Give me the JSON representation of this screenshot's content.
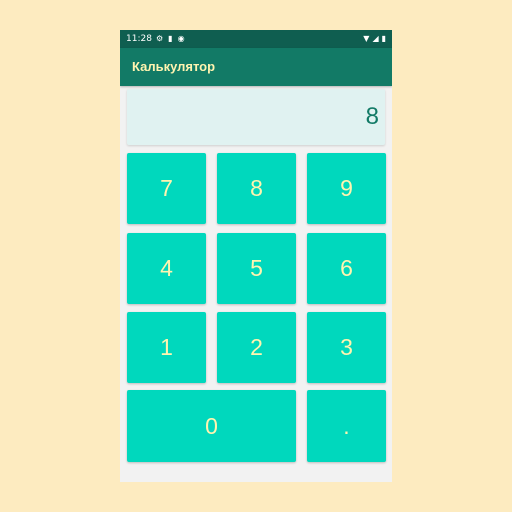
{
  "status_bar": {
    "time": "11:28",
    "left_icons": [
      "gear-icon",
      "sd-card-icon",
      "sync-icon"
    ],
    "right_icons": [
      "wifi-icon",
      "signal-icon",
      "battery-icon"
    ]
  },
  "app_bar": {
    "title": "Калькулятор"
  },
  "display": {
    "value": "8"
  },
  "keypad": {
    "k7": "7",
    "k8": "8",
    "k9": "9",
    "k4": "4",
    "k5": "5",
    "k6": "6",
    "k1": "1",
    "k2": "2",
    "k3": "3",
    "k0": "0",
    "kdot": "."
  },
  "colors": {
    "page_background": "#fdebc0",
    "status_bar": "#0f5e50",
    "app_bar": "#127a66",
    "title_text": "#fff4b0",
    "display_background": "#e0f2f1",
    "display_text": "#127a66",
    "key_background": "#00d8bd",
    "key_text": "#fff4b0"
  }
}
